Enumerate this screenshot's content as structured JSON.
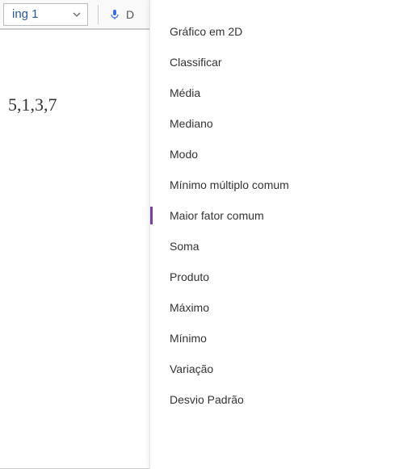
{
  "toolbar": {
    "style_label": "ing 1",
    "mic_label": "D"
  },
  "document": {
    "content": "5,1,3,7"
  },
  "menu": {
    "items": [
      {
        "label": "Gráfico em 2D",
        "selected": false
      },
      {
        "label": "Classificar",
        "selected": false
      },
      {
        "label": "Média",
        "selected": false
      },
      {
        "label": "Mediano",
        "selected": false
      },
      {
        "label": "Modo",
        "selected": false
      },
      {
        "label": "Mínimo múltiplo comum",
        "selected": false
      },
      {
        "label": "Maior fator comum",
        "selected": true
      },
      {
        "label": "Soma",
        "selected": false
      },
      {
        "label": "Produto",
        "selected": false
      },
      {
        "label": "Máximo",
        "selected": false
      },
      {
        "label": "Mínimo",
        "selected": false
      },
      {
        "label": "Variação",
        "selected": false
      },
      {
        "label": "Desvio Padrão",
        "selected": false
      }
    ]
  }
}
